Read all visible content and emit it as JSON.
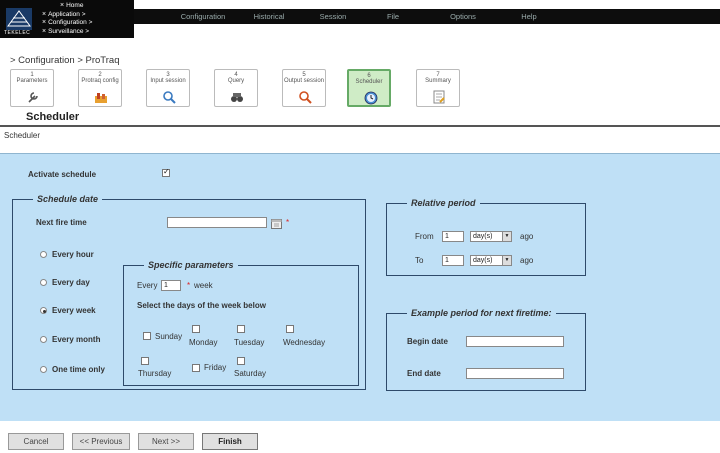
{
  "nav": {
    "links": [
      "Home",
      "Application >",
      "Configuration >",
      "Surveillance >"
    ],
    "brand": "TEKELEC",
    "menu": [
      "Configuration",
      "Historical",
      "Session",
      "File",
      "Options",
      "Help"
    ]
  },
  "breadcrumb": "> Configuration > ProTraq",
  "steps": [
    {
      "n": "1",
      "label": "Parameters",
      "icon": "wrench-icon"
    },
    {
      "n": "2",
      "label": "Protraq config",
      "icon": "chart-icon"
    },
    {
      "n": "3",
      "label": "Input session",
      "icon": "magnifier-icon"
    },
    {
      "n": "4",
      "label": "Query",
      "icon": "binoculars-icon"
    },
    {
      "n": "5",
      "label": "Output session",
      "icon": "magnifier-icon"
    },
    {
      "n": "6",
      "label": "Scheduler",
      "icon": "clock-icon"
    },
    {
      "n": "7",
      "label": "Summary",
      "icon": "document-icon"
    }
  ],
  "page_title": "Scheduler",
  "subtitle": "Scheduler",
  "form": {
    "activate_label": "Activate schedule",
    "activate_checked": true,
    "schedule_date": {
      "legend": "Schedule date",
      "next_fire_label": "Next fire time",
      "next_fire_value": "",
      "required_mark": "*",
      "options": [
        "Every hour",
        "Every day",
        "Every week",
        "Every month",
        "One time only"
      ],
      "selected": "Every week"
    },
    "specific": {
      "legend": "Specific parameters",
      "every_label": "Every",
      "every_value": "1",
      "unit": "week",
      "required_mark": "*",
      "days_prompt": "Select the days of the week below",
      "days": [
        "Sunday",
        "Monday",
        "Tuesday",
        "Wednesday",
        "Thursday",
        "Friday",
        "Saturday"
      ]
    },
    "relative": {
      "legend": "Relative period",
      "from_label": "From",
      "from_value": "1",
      "from_unit": "day(s)",
      "to_label": "To",
      "to_value": "1",
      "to_unit": "day(s)",
      "ago": "ago"
    },
    "example": {
      "legend": "Example period for next firetime:",
      "begin_label": "Begin date",
      "begin_value": "",
      "end_label": "End date",
      "end_value": ""
    }
  },
  "buttons": {
    "cancel": "Cancel",
    "previous": "<< Previous",
    "next": "Next >>",
    "finish": "Finish"
  }
}
